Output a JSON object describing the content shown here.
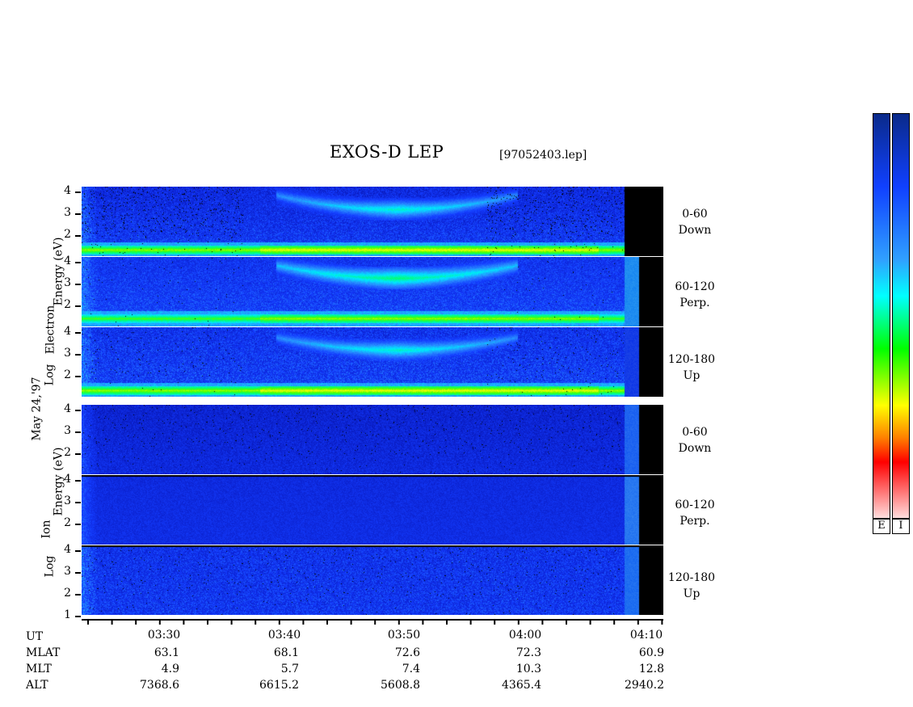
{
  "title": "EXOS-D LEP",
  "filename": "[97052403.lep]",
  "date_label": "May 24,'97",
  "electron_group": {
    "ylabel_parts": [
      "Log",
      "Electron",
      "Energy",
      "(eV)"
    ],
    "panels": [
      {
        "range": "0-60",
        "dir": "Down"
      },
      {
        "range": "60-120",
        "dir": "Perp."
      },
      {
        "range": "120-180",
        "dir": "Up"
      }
    ]
  },
  "ion_group": {
    "ylabel_parts": [
      "Log",
      "Ion",
      "Energy",
      "(eV)"
    ],
    "panels": [
      {
        "range": "0-60",
        "dir": "Down"
      },
      {
        "range": "60-120",
        "dir": "Perp."
      },
      {
        "range": "120-180",
        "dir": "Up"
      }
    ]
  },
  "y_ticks": [
    "4",
    "3",
    "2"
  ],
  "y_ticks_bottom": [
    "4",
    "3",
    "2",
    "1"
  ],
  "x_axis": {
    "ut": [
      "03:30",
      "03:40",
      "03:50",
      "04:00",
      "04:10"
    ],
    "rows": [
      {
        "label": "UT"
      },
      {
        "label": "MLAT",
        "values": [
          "63.1",
          "68.1",
          "72.6",
          "72.3",
          "60.9"
        ]
      },
      {
        "label": "MLT",
        "values": [
          "4.9",
          "5.7",
          "7.4",
          "10.3",
          "12.8"
        ]
      },
      {
        "label": "ALT",
        "values": [
          "7368.6",
          "6615.2",
          "5608.8",
          "4365.4",
          "2940.2"
        ]
      }
    ]
  },
  "colorbar": {
    "labels": [
      "E",
      "I"
    ],
    "colors": [
      "#0a2a8a",
      "#1040ff",
      "#30a0ff",
      "#00ffff",
      "#00ff00",
      "#ffff00",
      "#ff8000",
      "#ff0000",
      "#ffe0e0"
    ]
  },
  "chart_data": {
    "type": "heatmap",
    "title": "EXOS-D LEP",
    "ylabel": "Log Electron Energy (eV) / Log Ion Energy (eV)",
    "xlabel": "UT",
    "x": [
      "03:30",
      "03:40",
      "03:50",
      "04:00",
      "04:10"
    ],
    "ylim": [
      1,
      4.2
    ],
    "series": [
      {
        "name": "Electron 0-60 Down"
      },
      {
        "name": "Electron 60-120 Perp."
      },
      {
        "name": "Electron 120-180 Up"
      },
      {
        "name": "Ion 0-60 Down"
      },
      {
        "name": "Ion 60-120 Perp."
      },
      {
        "name": "Ion 120-180 Up"
      }
    ]
  }
}
